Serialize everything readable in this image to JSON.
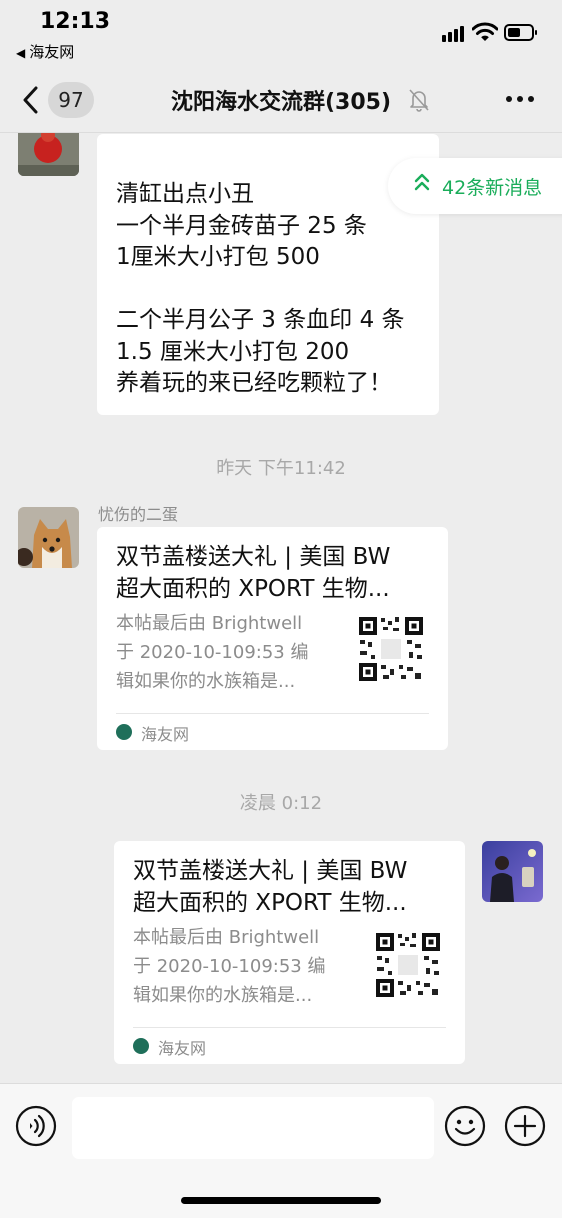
{
  "status_bar": {
    "time": "12:13",
    "back_app": "海友网",
    "icons": [
      "signal-icon",
      "wifi-icon",
      "battery-icon"
    ]
  },
  "nav": {
    "unread_count": "97",
    "title": "沈阳海水交流群(305)",
    "icons": [
      "back-chevron-icon",
      "mute-bell-icon",
      "more-icon"
    ]
  },
  "new_messages_pill": "42条新消息",
  "messages": [
    {
      "type": "text",
      "side": "left",
      "text": "清缸出点小丑\n一个半月金砖苗子 25 条\n1厘米大小打包 500\n\n二个半月公子 3 条血印 4 条\n1.5 厘米大小打包 200\n养着玩的来已经吃颗粒了！"
    },
    {
      "type": "time",
      "text": "昨天 下午11:42"
    },
    {
      "type": "link_card",
      "side": "left",
      "sender": "忧伤的二蛋",
      "title_line1": "双节盖楼送大礼 | 美国 BW",
      "title_line2": "超大面积的 XPORT 生物...",
      "desc_line1": "本帖最后由 Brightwell",
      "desc_line2": "于 2020-10-109:53 编",
      "desc_line3": "辑如果你的水族箱是...",
      "source": "海友网"
    },
    {
      "type": "time",
      "text": "凌晨 0:12"
    },
    {
      "type": "link_card",
      "side": "right",
      "title_line1": "双节盖楼送大礼 | 美国 BW",
      "title_line2": "超大面积的 XPORT 生物...",
      "desc_line1": "本帖最后由 Brightwell",
      "desc_line2": "于 2020-10-109:53 编",
      "desc_line3": "辑如果你的水族箱是...",
      "source": "海友网"
    }
  ],
  "input_bar": {
    "icons": [
      "voice-icon",
      "emoji-icon",
      "plus-icon"
    ]
  },
  "colors": {
    "accent_green": "#1aad5a",
    "background": "#ededed",
    "bubble": "#ffffff"
  }
}
